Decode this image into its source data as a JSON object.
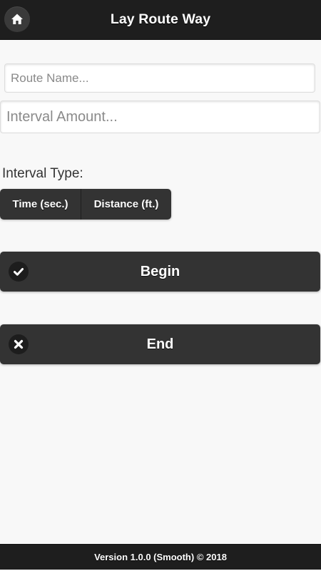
{
  "header": {
    "title": "Lay Route Way",
    "home_icon": "home-icon"
  },
  "form": {
    "route_name_placeholder": "Route Name...",
    "interval_amount_placeholder": "Interval Amount...",
    "interval_type_label": "Interval Type:",
    "interval_options": [
      {
        "label": "Time (sec.)"
      },
      {
        "label": "Distance (ft.)"
      }
    ]
  },
  "actions": {
    "begin": {
      "label": "Begin",
      "icon": "check-icon"
    },
    "end": {
      "label": "End",
      "icon": "close-icon"
    }
  },
  "footer": {
    "version_text": "Version 1.0.0 (Smooth) © 2018"
  },
  "colors": {
    "bar_background": "#1e1e1e",
    "button_background": "#333333",
    "page_background": "#f8f8f8"
  }
}
